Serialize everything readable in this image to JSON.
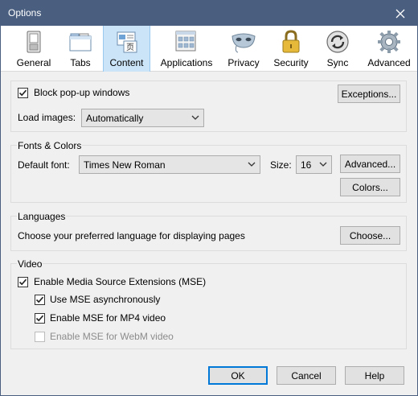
{
  "window": {
    "title": "Options"
  },
  "toolbar": {
    "items": [
      {
        "label": "General",
        "icon": "general-icon",
        "selected": false
      },
      {
        "label": "Tabs",
        "icon": "tabs-icon",
        "selected": false
      },
      {
        "label": "Content",
        "icon": "content-icon",
        "selected": true
      },
      {
        "label": "Applications",
        "icon": "applications-icon",
        "selected": false
      },
      {
        "label": "Privacy",
        "icon": "privacy-mask-icon",
        "selected": false
      },
      {
        "label": "Security",
        "icon": "padlock-icon",
        "selected": false
      },
      {
        "label": "Sync",
        "icon": "sync-icon",
        "selected": false
      },
      {
        "label": "Advanced",
        "icon": "gear-icon",
        "selected": false
      }
    ]
  },
  "popups": {
    "block_label": "Block pop-up windows",
    "block_checked": true,
    "exceptions_button": "Exceptions...",
    "load_images_label": "Load images:",
    "load_images_value": "Automatically"
  },
  "fonts": {
    "title": "Fonts & Colors",
    "default_font_label": "Default font:",
    "default_font_value": "Times New Roman",
    "size_label": "Size:",
    "size_value": "16",
    "advanced_button": "Advanced...",
    "colors_button": "Colors..."
  },
  "languages": {
    "title": "Languages",
    "description": "Choose your preferred language for displaying pages",
    "choose_button": "Choose..."
  },
  "video": {
    "title": "Video",
    "mse_label": "Enable Media Source Extensions (MSE)",
    "mse_checked": true,
    "async_label": "Use MSE asynchronously",
    "async_checked": true,
    "mp4_label": "Enable MSE for MP4 video",
    "mp4_checked": true,
    "webm_label": "Enable MSE for WebM video",
    "webm_checked": false,
    "webm_disabled": true
  },
  "footer": {
    "ok_button": "OK",
    "cancel_button": "Cancel",
    "help_button": "Help"
  },
  "colors": {
    "titlebar": "#4a5f80",
    "selected_tab": "#cce4f7",
    "default_button_border": "#0078d7"
  }
}
